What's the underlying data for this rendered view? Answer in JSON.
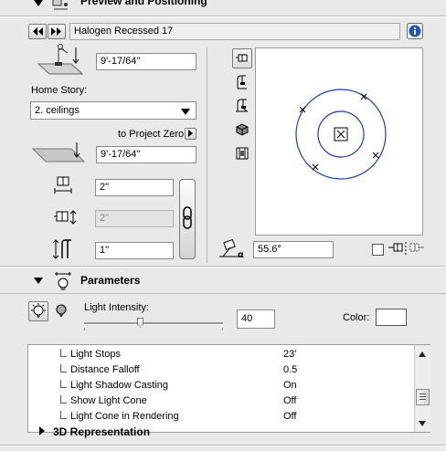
{
  "preview_section": {
    "title": "Preview and Positioning",
    "nav_prev": "◀◀",
    "nav_next": "▶▶",
    "object_name": "Halogen Recessed 17",
    "elevation_value": "9'-17/64\"",
    "home_story_label": "Home Story:",
    "home_story_value": "2. ceilings",
    "project_zero_label": "to Project Zero",
    "project_zero_value": "9'-17/64\"",
    "width_value": "2\"",
    "depth_value": "2\"",
    "height_value": "1\"",
    "angle_value": "55.6°"
  },
  "parameters_section": {
    "title": "Parameters",
    "light_intensity_label": "Light Intensity:",
    "light_intensity_value": "40",
    "light_intensity_level": 0.4,
    "color_label": "Color:",
    "color_swatch": "#ffffff",
    "rows": [
      {
        "name": "Light Stops",
        "value": "23'"
      },
      {
        "name": "Distance Falloff",
        "value": "0.5"
      },
      {
        "name": "Light Shadow Casting",
        "value": "On"
      },
      {
        "name": "Show Light Cone",
        "value": "Off"
      },
      {
        "name": "Light Cone in Rendering",
        "value": "Off"
      }
    ],
    "group_label": "3D Representation"
  },
  "colors": {
    "preview_circle": "#1f3fa8",
    "info_button": "#1d55b8"
  }
}
